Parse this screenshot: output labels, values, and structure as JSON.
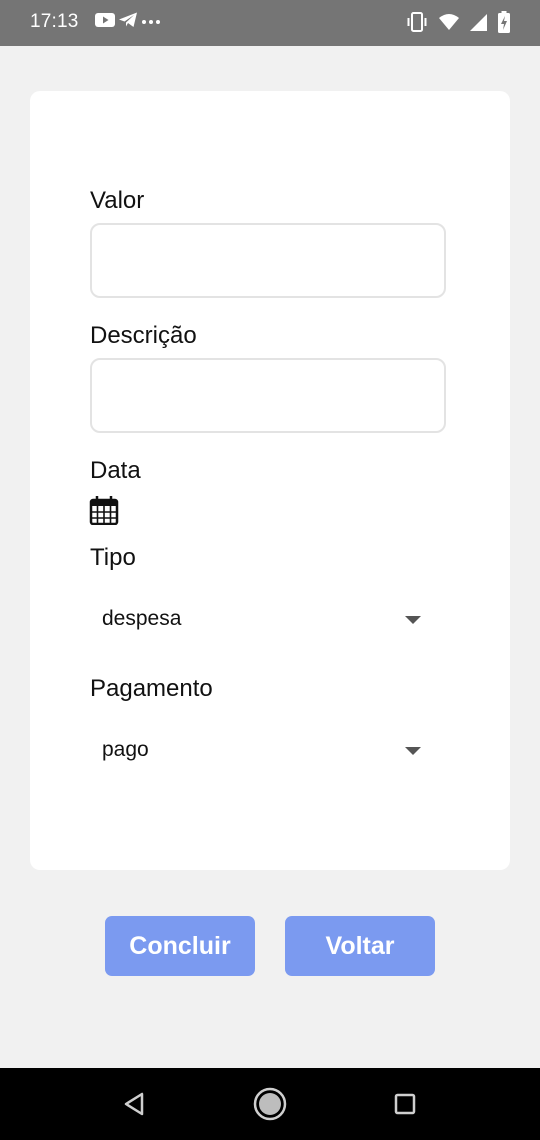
{
  "status_bar": {
    "time": "17:13",
    "notification_icons": [
      "youtube-icon",
      "telegram-icon",
      "more-dots-icon"
    ],
    "system_icons": [
      "vibrate-icon",
      "wifi-icon",
      "signal-icon",
      "battery-charging-icon"
    ]
  },
  "form": {
    "valor": {
      "label": "Valor",
      "value": "",
      "placeholder": ""
    },
    "descricao": {
      "label": "Descrição",
      "value": "",
      "placeholder": ""
    },
    "data": {
      "label": "Data",
      "icon": "calendar-icon"
    },
    "tipo": {
      "label": "Tipo",
      "selected": "despesa"
    },
    "pagamento": {
      "label": "Pagamento",
      "selected": "pago"
    }
  },
  "actions": {
    "concluir_label": "Concluir",
    "voltar_label": "Voltar"
  },
  "navigation": {
    "buttons": [
      "back-icon",
      "home-icon",
      "recents-icon"
    ]
  },
  "colors": {
    "status_bar": "#757575",
    "background": "#f1f1f1",
    "card": "#ffffff",
    "button": "#7b9af0",
    "button_text": "#ffffff",
    "nav_bar": "#000000"
  }
}
